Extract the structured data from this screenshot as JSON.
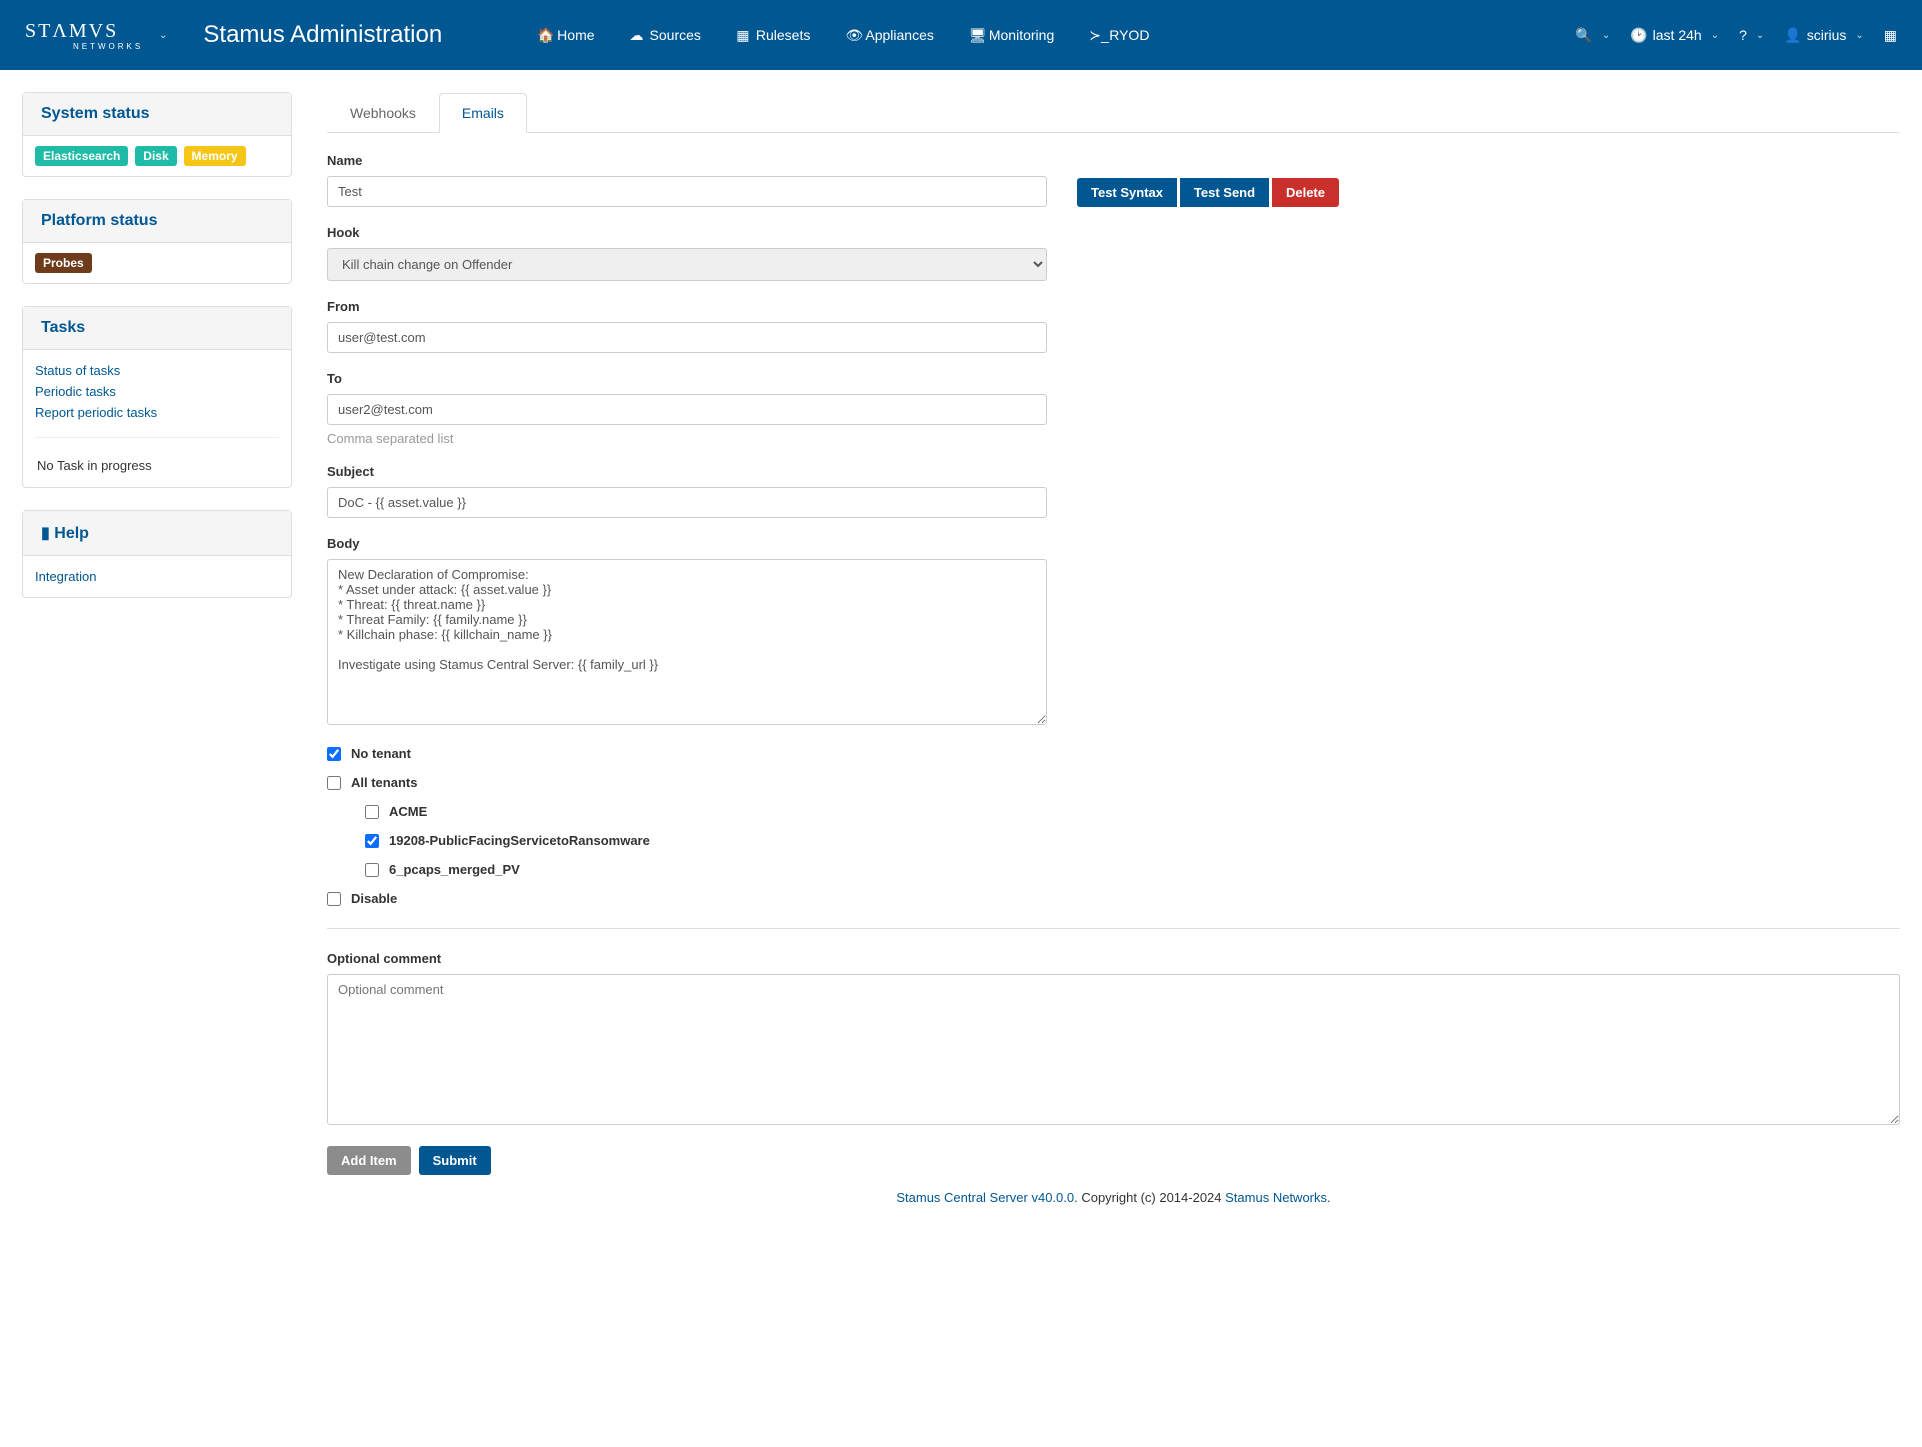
{
  "header": {
    "app_title": "Stamus Administration",
    "nav": {
      "home": "Home",
      "sources": "Sources",
      "rulesets": "Rulesets",
      "appliances": "Appliances",
      "monitoring": "Monitoring",
      "ryod": "RYOD"
    },
    "time_range": "last 24h",
    "user": "scirius"
  },
  "sidebar": {
    "system_status": {
      "title": "System status",
      "badges": {
        "es": "Elasticsearch",
        "disk": "Disk",
        "memory": "Memory"
      }
    },
    "platform_status": {
      "title": "Platform status",
      "badges": {
        "probes": "Probes"
      }
    },
    "tasks": {
      "title": "Tasks",
      "links": {
        "status": "Status of tasks",
        "periodic": "Periodic tasks",
        "report": "Report periodic tasks"
      },
      "empty": "No Task in progress"
    },
    "help": {
      "title": "Help",
      "links": {
        "integration": "Integration"
      }
    }
  },
  "tabs": {
    "webhooks": "Webhooks",
    "emails": "Emails"
  },
  "form": {
    "name": {
      "label": "Name",
      "value": "Test"
    },
    "hook": {
      "label": "Hook",
      "value": "Kill chain change on Offender",
      "options": [
        "Kill chain change on Offender"
      ]
    },
    "from": {
      "label": "From",
      "value": "user@test.com"
    },
    "to": {
      "label": "To",
      "value": "user2@test.com",
      "help": "Comma separated list"
    },
    "subject": {
      "label": "Subject",
      "value": "DoC - {{ asset.value }}"
    },
    "body": {
      "label": "Body",
      "value": "New Declaration of Compromise:\n* Asset under attack: {{ asset.value }}\n* Threat: {{ threat.name }}\n* Threat Family: {{ family.name }}\n* Killchain phase: {{ killchain_name }}\n\nInvestigate using Stamus Central Server: {{ family_url }}"
    },
    "no_tenant": {
      "label": "No tenant",
      "checked": true
    },
    "all_tenants": {
      "label": "All tenants",
      "checked": false
    },
    "tenants": [
      {
        "label": "ACME",
        "checked": false
      },
      {
        "label": "19208-PublicFacingServicetoRansomware",
        "checked": true
      },
      {
        "label": "6_pcaps_merged_PV",
        "checked": false
      }
    ],
    "disable": {
      "label": "Disable",
      "checked": false
    },
    "optional_comment": {
      "label": "Optional comment",
      "placeholder": "Optional comment"
    }
  },
  "buttons": {
    "test_syntax": "Test Syntax",
    "test_send": "Test Send",
    "delete": "Delete",
    "add_item": "Add Item",
    "submit": "Submit"
  },
  "footer": {
    "product": "Stamus Central Server v40.0.0",
    "copyright": ". Copyright (c) 2014-2024 ",
    "company": "Stamus Networks",
    "period": "."
  }
}
